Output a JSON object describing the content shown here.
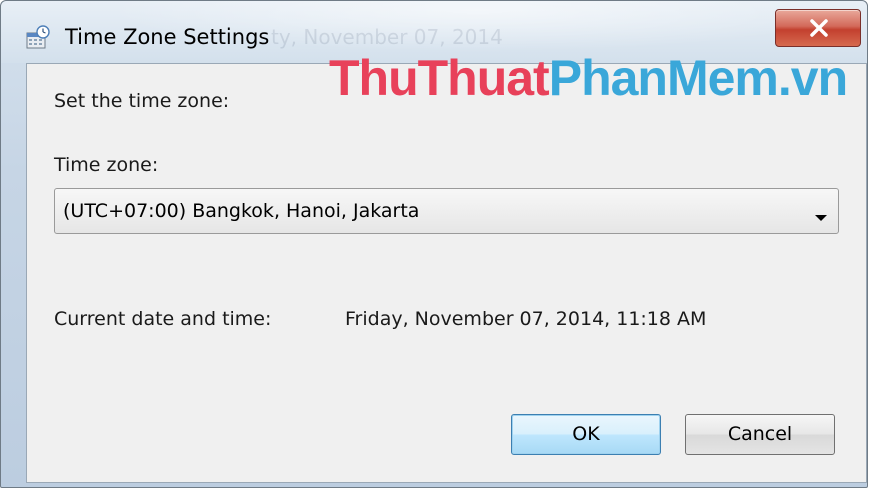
{
  "window": {
    "title": "Time Zone Settings",
    "background_title_ghost": "ty, November 07, 2014"
  },
  "watermark": {
    "part1": "ThuThuat",
    "part2": "PhanMem.vn"
  },
  "content": {
    "heading": "Set the time zone:",
    "timezone_label": "Time zone:",
    "timezone_selected": "(UTC+07:00) Bangkok, Hanoi, Jakarta",
    "datetime_label": "Current date and time:",
    "datetime_value": "Friday, November 07, 2014, 11:18 AM"
  },
  "buttons": {
    "ok": "OK",
    "cancel": "Cancel"
  },
  "colors": {
    "close_button": "#c3402f",
    "watermark_red": "#e8415a",
    "watermark_blue": "#3aa7d9",
    "default_button_border": "#3c7fb1"
  },
  "icons": {
    "title": "time-zone-settings-icon",
    "close": "close-icon",
    "dropdown": "chevron-down-icon"
  }
}
